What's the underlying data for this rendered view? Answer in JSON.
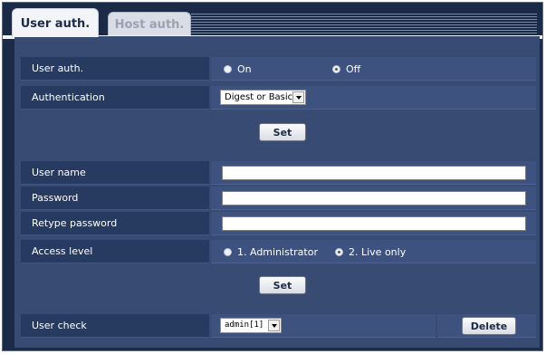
{
  "tabs": [
    {
      "label": "User auth."
    },
    {
      "label": "Host auth."
    }
  ],
  "auth_section": {
    "user_auth_label": "User auth.",
    "user_auth_on": "On",
    "user_auth_off": "Off",
    "user_auth_selected": "Off",
    "authentication_label": "Authentication",
    "authentication_value": "Digest or Basic",
    "set_label": "Set"
  },
  "user_section": {
    "user_name_label": "User name",
    "user_name_value": "",
    "password_label": "Password",
    "password_value": "",
    "retype_password_label": "Retype password",
    "retype_password_value": "",
    "access_level_label": "Access level",
    "access_option_1": "1. Administrator",
    "access_option_2": "2. Live only",
    "access_selected": "2. Live only",
    "set_label": "Set"
  },
  "user_check": {
    "label": "User check",
    "selected_user": "admin[1]",
    "delete_label": "Delete"
  }
}
